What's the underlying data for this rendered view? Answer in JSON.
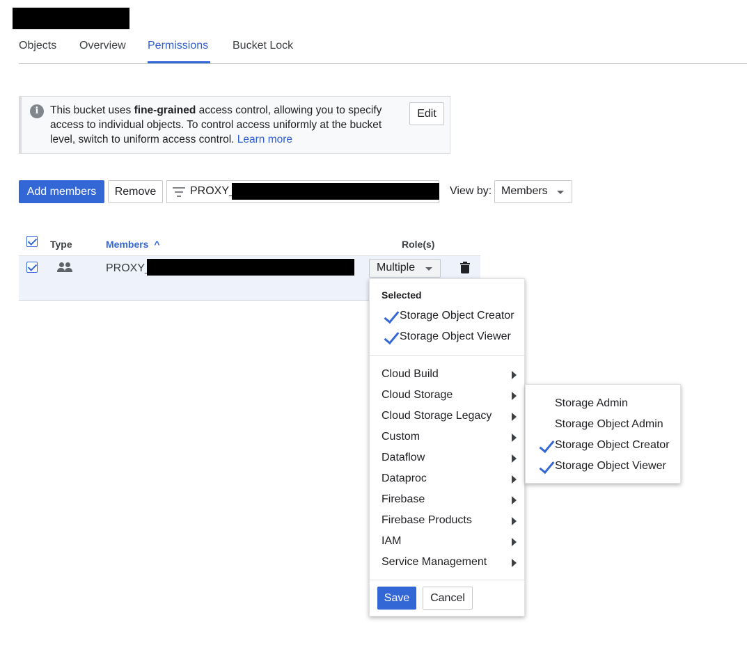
{
  "header": {
    "tabs": [
      {
        "label": "Objects"
      },
      {
        "label": "Overview"
      },
      {
        "label": "Permissions"
      },
      {
        "label": "Bucket Lock"
      }
    ]
  },
  "info": {
    "text_before": "This bucket uses ",
    "text_bold": "fine-grained",
    "text_after": " access control, allowing you to specify access to individual objects. To control access uniformly at the bucket level, switch to uniform access control. ",
    "link": "Learn more",
    "edit_label": "Edit"
  },
  "toolbar": {
    "add_members_label": "Add members",
    "remove_label": "Remove",
    "filter_value": "PROXY_",
    "view_by_label": "View by:",
    "view_by_value": "Members"
  },
  "table": {
    "headers": {
      "type": "Type",
      "members": "Members",
      "sort_indicator": "^",
      "roles": "Role(s)"
    },
    "rows": [
      {
        "member": "PROXY_",
        "role": "Multiple"
      }
    ]
  },
  "role_menu": {
    "selected_header": "Selected",
    "selected_items": [
      "Storage Object Creator",
      "Storage Object Viewer"
    ],
    "categories": [
      "Cloud Build",
      "Cloud Storage",
      "Cloud Storage Legacy",
      "Custom",
      "Dataflow",
      "Dataproc",
      "Firebase",
      "Firebase Products",
      "IAM",
      "Service Management"
    ],
    "save_label": "Save",
    "cancel_label": "Cancel"
  },
  "submenu": {
    "items": [
      {
        "label": "Storage Admin",
        "checked": false
      },
      {
        "label": "Storage Object Admin",
        "checked": false
      },
      {
        "label": "Storage Object Creator",
        "checked": true
      },
      {
        "label": "Storage Object Viewer",
        "checked": true
      }
    ]
  },
  "colors": {
    "accent": "#3367d6",
    "text": "#202124"
  }
}
